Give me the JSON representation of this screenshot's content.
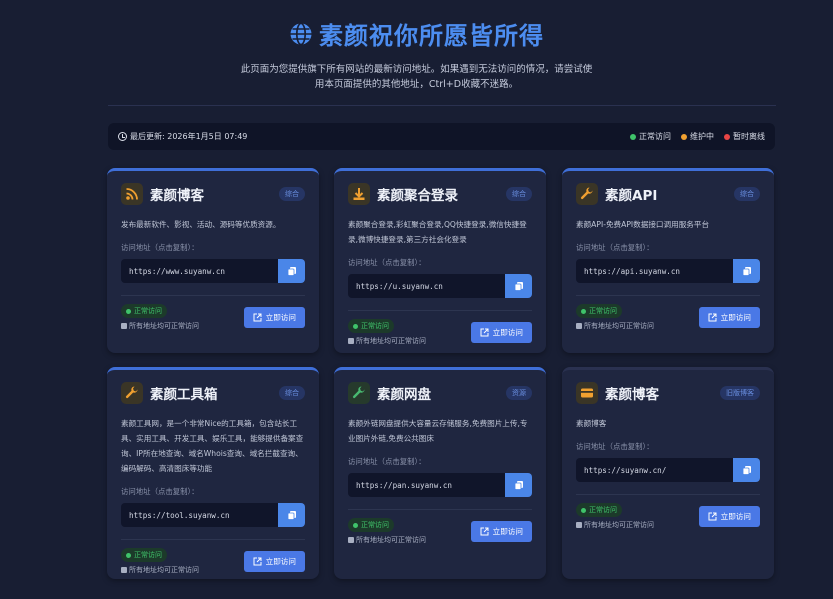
{
  "header": {
    "title": "素颜祝你所愿皆所得",
    "subtitle": "此页面为您提供旗下所有网站的最新访问地址。如果遇到无法访问的情况，请尝试使用本页面提供的其他地址，Ctrl+D收藏不迷路。"
  },
  "statusbar": {
    "updated": "最后更新: 2026年1月5日 07:49",
    "legend": [
      {
        "label": "正常访问",
        "color": "#3fc36a"
      },
      {
        "label": "维护中",
        "color": "#f0a030"
      },
      {
        "label": "暂时离线",
        "color": "#e84545"
      }
    ]
  },
  "common": {
    "addr_label": "访问地址（点击复制）：",
    "status_ok": "正常访问",
    "note": "所有地址均可正常访问",
    "visit": "立即访问"
  },
  "cards": [
    {
      "icon": "rss-icon",
      "title": "素颜博客",
      "tag": "综合",
      "desc": "发布最新软件、影视、活动、源码等优质资源。",
      "url": "https://www.suyanw.cn"
    },
    {
      "icon": "download-icon",
      "title": "素颜聚合登录",
      "tag": "综合",
      "desc": "素颜聚合登录,彩虹聚合登录,QQ快捷登录,微信快捷登录,微博快捷登录,第三方社会化登录",
      "url": "https://u.suyanw.cn"
    },
    {
      "icon": "wrench-icon",
      "title": "素颜API",
      "tag": "综合",
      "desc": "素颜API-免费API数据接口调用服务平台",
      "url": "https://api.suyanw.cn"
    },
    {
      "icon": "wrench-icon",
      "title": "素颜工具箱",
      "tag": "综合",
      "desc": "素颜工具网，是一个非常Nice的工具箱，包含站长工具、实用工具、开发工具、娱乐工具，能够提供备案查询、IP所在地查询、域名Whois查询、域名拦截查询、编码解码、高清图床等功能",
      "url": "https://tool.suyanw.cn"
    },
    {
      "icon": "wrench-icon",
      "title": "素颜网盘",
      "tag": "资源",
      "desc": "素颜外链网盘提供大容量云存储服务,免费图片上传,专业图片外链,免费公共图床",
      "url": "https://pan.suyanw.cn"
    },
    {
      "icon": "card-icon",
      "title": "素颜博客",
      "tag": "旧版博客",
      "desc": "素颜博客",
      "url": "https://suyanw.cn/"
    }
  ]
}
